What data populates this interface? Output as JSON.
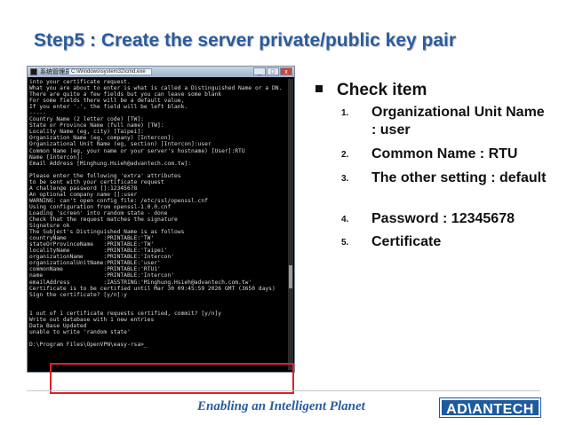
{
  "title": "Step5 : Create the server private/public key pair",
  "console": {
    "window_title": "系统管理员",
    "window_path": "C:\\Windows\\system32\\cmd.exe",
    "buttons": [
      "_",
      "□",
      "x"
    ],
    "lines": [
      "into your certificate request.",
      "What you are about to enter is what is called a Distinguished Name or a DN.",
      "There are quite a few fields but you can leave some blank",
      "For some fields there will be a default value,",
      "If you enter '.', the field will be left blank.",
      "-----",
      "Country Name (2 letter code) [TW]:",
      "State or Province Name (full name) [TW]:",
      "Locality Name (eg, city) [Taipei]:",
      "Organization Name (eg, company) [Intercon]:",
      "Organizational Unit Name (eg, section) [Intercon]:user",
      "Common Name (eg, your name or your server's hostname) [User]:RTU",
      "Name [Intercon]:",
      "Email Address [Minghung.Hsieh@advantech.com.tw]:",
      "",
      "Please enter the following 'extra' attributes",
      "to be sent with your certificate request",
      "A challenge password []:12345678",
      "An optional company name []:user",
      "WARNING: can't open config file: /etc/ssl/openssl.cnf",
      "Using configuration from openssl-1.0.0.cnf",
      "Loading 'screen' into random state - done",
      "Check that the request matches the signature",
      "Signature ok",
      "The Subject's Distinguished Name is as follows",
      "countryName           :PRINTABLE:'TW'",
      "stateOrProvinceName   :PRINTABLE:'TW'",
      "localityName          :PRINTABLE:'Taipei'",
      "organizationName      :PRINTABLE:'Intercon'",
      "organizationalUnitName:PRINTABLE:'user'",
      "commonName            :PRINTABLE:'RTU1'",
      "name                  :PRINTABLE:'Intercon'",
      "emailAddress          :IA5STRING:'Minghung.Hsieh@advantech.com.tw'",
      "Certificate is to be certified until Mar 30 09:45:59 2026 GMT (3650 days)",
      "Sign the certificate? [y/n]:y",
      "",
      "",
      "1 out of 1 certificate requests certified, commit? [y/n]y",
      "Write out database with 1 new entries",
      "Data Base Updated",
      "unable to write 'random state'",
      "",
      "D:\\Program Files\\OpenVPN\\easy-rsa>_"
    ]
  },
  "check": {
    "heading": "Check item",
    "items": [
      {
        "num": "1.",
        "text": "Organizational Unit Name : user"
      },
      {
        "num": "2.",
        "text": "Common Name : RTU"
      },
      {
        "num": "3.",
        "text": "The other setting : default"
      },
      {
        "num": "4.",
        "text": "Password : 12345678"
      },
      {
        "num": "5.",
        "text": "Certificate"
      }
    ]
  },
  "footer": {
    "tagline": "Enabling an Intelligent Planet",
    "logo": "AD\\ANTECH"
  },
  "colors": {
    "title": "#2a5c9e",
    "highlight": "#e0202a",
    "logo_bg": "#1d5a9f"
  }
}
